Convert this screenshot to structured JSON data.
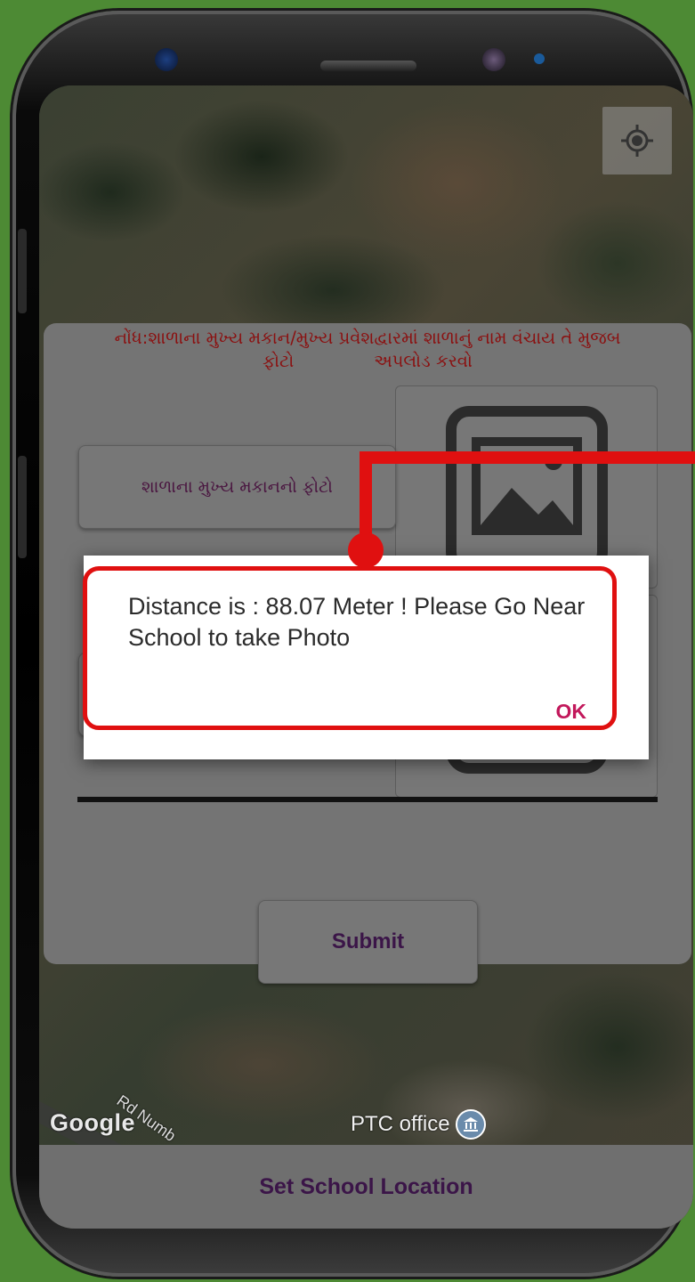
{
  "map": {
    "attribution": "Google",
    "road_label": "Rd Numb",
    "poi_label": "PTC office"
  },
  "form": {
    "note_line1": "નોંધ:શાળાના મુખ્ય મકાન/મુખ્ય પ્રવેશદ્વારમાં શાળાનું નામ વંચાય તે મુજબ",
    "note_line2a": "ફોટો",
    "note_line2b": "અપલોડ કરવો",
    "photo_button_label": "શાળાના મુખ્ય મકાનનો ફોટો",
    "submit_label": "Submit"
  },
  "dialog": {
    "message": "Distance is : 88.07 Meter ! Please Go Near School to take Photo",
    "ok_label": "OK"
  },
  "bottom_bar": {
    "set_location_label": "Set School Location"
  },
  "colors": {
    "background": "#4d8a34",
    "annotation": "#e01010",
    "ok_accent": "#c2185b",
    "note_text": "#8b1010",
    "button_text": "#3b1548"
  }
}
